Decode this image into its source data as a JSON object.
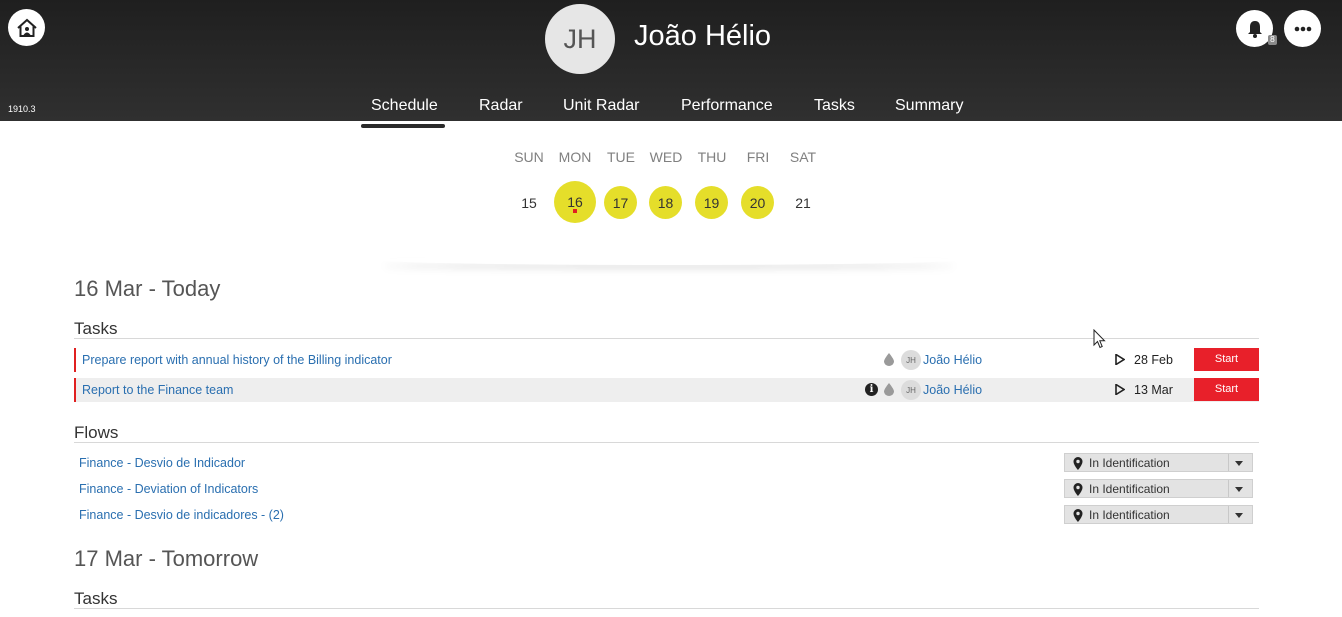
{
  "header": {
    "version": "1910.3",
    "user_initials": "JH",
    "user_name": "João Hélio",
    "notification_count": "8",
    "tabs": [
      {
        "label": "Schedule",
        "active": true
      },
      {
        "label": "Radar",
        "active": false
      },
      {
        "label": "Unit Radar",
        "active": false
      },
      {
        "label": "Performance",
        "active": false
      },
      {
        "label": "Tasks",
        "active": false
      },
      {
        "label": "Summary",
        "active": false
      }
    ]
  },
  "calendar": {
    "weekdays": [
      "SUN",
      "MON",
      "TUE",
      "WED",
      "THU",
      "FRI",
      "SAT"
    ],
    "days": [
      {
        "number": "15",
        "has_task": false,
        "today": false
      },
      {
        "number": "16",
        "has_task": true,
        "today": true
      },
      {
        "number": "17",
        "has_task": true,
        "today": false
      },
      {
        "number": "18",
        "has_task": true,
        "today": false
      },
      {
        "number": "19",
        "has_task": true,
        "today": false
      },
      {
        "number": "20",
        "has_task": true,
        "today": false
      },
      {
        "number": "21",
        "has_task": false,
        "today": false
      }
    ],
    "highlight_color": "#e5de2a"
  },
  "today": {
    "heading": "16 Mar - Today",
    "tasks_title": "Tasks",
    "tasks": [
      {
        "title": "Prepare report with annual history of the Billing indicator",
        "has_info": false,
        "assignee_initials": "JH",
        "assignee": "João Hélio",
        "due": "28 Feb",
        "action": "Start"
      },
      {
        "title": "Report to the Finance team",
        "has_info": true,
        "assignee_initials": "JH",
        "assignee": "João Hélio",
        "due": "13 Mar",
        "action": "Start"
      }
    ],
    "flows_title": "Flows",
    "flows": [
      {
        "title": "Finance - Desvio de Indicador",
        "state": "In Identification"
      },
      {
        "title": "Finance - Deviation of Indicators",
        "state": "In Identification"
      },
      {
        "title": "Finance - Desvio de indicadores - (2)",
        "state": "In Identification"
      }
    ]
  },
  "tomorrow": {
    "heading": "17 Mar - Tomorrow",
    "tasks_title": "Tasks"
  },
  "colors": {
    "accent_red": "#e8202a",
    "link_blue": "#2a6fb0"
  }
}
